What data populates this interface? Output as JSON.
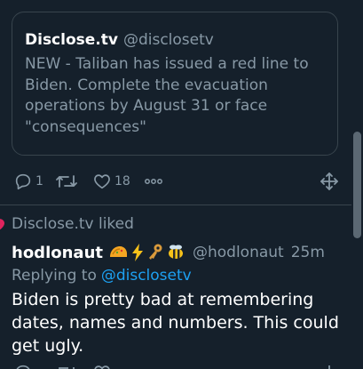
{
  "quote": {
    "name": "Disclose.tv",
    "handle": "@disclosetv",
    "text": "NEW - Taliban has issued a red line to Biden. Complete the evacuation operations by August 31 or face \"consequences\""
  },
  "actions": {
    "reply_count": "1",
    "retweet_count": "",
    "like_count": "18"
  },
  "liked_notice": "Disclose.tv liked",
  "reply": {
    "author_name": "hodlonaut",
    "author_handle": "@hodlonaut",
    "timestamp": "25m",
    "replying_to_label": "Replying to",
    "replying_to_handle": "@disclosetv",
    "text": "Biden is pretty bad at remembering dates, names and numbers. This could get ugly."
  },
  "icons": {
    "reply": "reply-icon",
    "retweet": "retweet-icon",
    "like": "heart-icon",
    "more": "more-icon",
    "move": "move-icon"
  },
  "colors": {
    "background": "#15202b",
    "border": "#38444d",
    "muted_text": "#8899a6",
    "link": "#1da1f2",
    "like_accent": "#e0245e"
  }
}
